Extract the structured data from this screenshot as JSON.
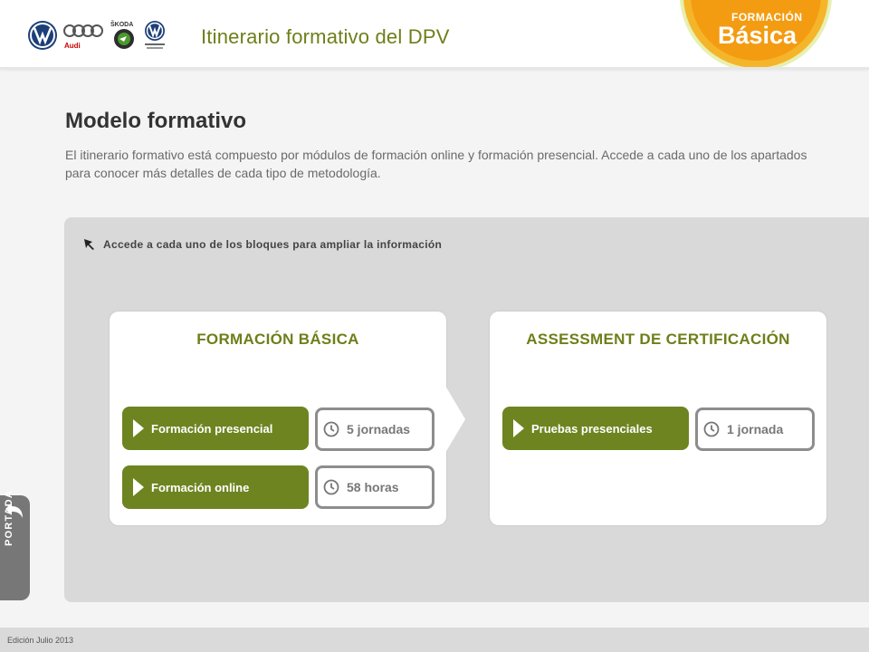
{
  "header": {
    "title": "Itinerario formativo del DPV",
    "logos": [
      "vw-logo-icon",
      "audi-logo-icon",
      "skoda-logo-icon",
      "vw-commercial-logo-icon"
    ],
    "badge": {
      "kicker": "FORMACIÓN",
      "title": "Básica"
    }
  },
  "main": {
    "title": "Modelo formativo",
    "intro": "El itinerario formativo está compuesto por módulos de formación online y formación presencial. Accede a cada uno de los apartados para conocer más detalles de cada tipo de metodología.",
    "hint": "Accede a cada uno de los bloques para ampliar la información"
  },
  "cards": [
    {
      "title": "FORMACIÓN BÁSICA",
      "items": [
        {
          "label": "Formación presencial",
          "duration": "5 jornadas"
        },
        {
          "label": "Formación online",
          "duration": "58 horas"
        }
      ]
    },
    {
      "title": "ASSESSMENT DE CERTIFICACIÓN",
      "items": [
        {
          "label": "Pruebas presenciales",
          "duration": "1 jornada"
        }
      ]
    }
  ],
  "side": {
    "portada_label": "PORTADA"
  },
  "footer": {
    "edition": "Edición Julio 2013"
  },
  "colors": {
    "accent": "#6e8420",
    "badge": "#f39c12",
    "panel": "#d9d9d9"
  }
}
